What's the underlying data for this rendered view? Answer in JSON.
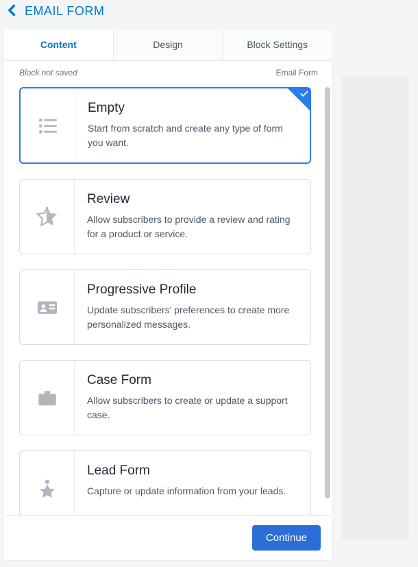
{
  "header": {
    "title": "EMAIL FORM"
  },
  "tabs": [
    {
      "label": "Content",
      "active": true
    },
    {
      "label": "Design",
      "active": false
    },
    {
      "label": "Block Settings",
      "active": false
    }
  ],
  "status": {
    "not_saved": "Block not saved",
    "context": "Email Form"
  },
  "templates": [
    {
      "icon": "list",
      "title": "Empty",
      "desc": "Start from scratch and create any type of form you want.",
      "selected": true
    },
    {
      "icon": "star",
      "title": "Review",
      "desc": "Allow subscribers to provide a review and rating for a product or service.",
      "selected": false
    },
    {
      "icon": "id-card",
      "title": "Progressive Profile",
      "desc": "Update subscribers' preferences to create more personalized messages.",
      "selected": false
    },
    {
      "icon": "briefcase",
      "title": "Case Form",
      "desc": "Allow subscribers to create or update a support case.",
      "selected": false
    },
    {
      "icon": "person-star",
      "title": "Lead Form",
      "desc": "Capture or update information from your leads.",
      "selected": false
    }
  ],
  "footer": {
    "continue": "Continue"
  }
}
